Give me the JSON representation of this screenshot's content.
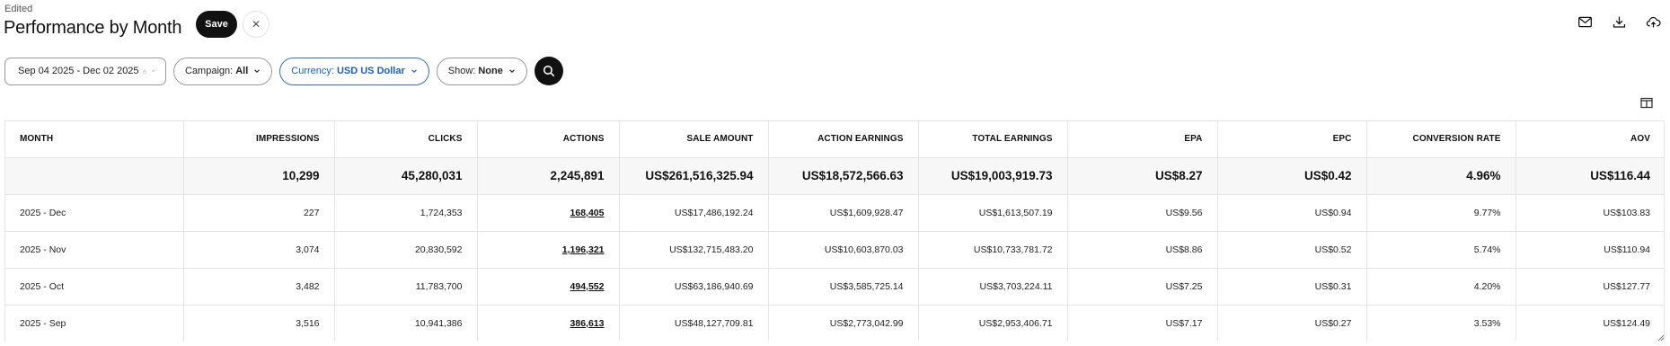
{
  "header": {
    "status": "Edited",
    "title": "Performance by Month",
    "save_label": "Save",
    "close_glyph": "✕"
  },
  "top_icons": [
    "mail-icon",
    "download-icon",
    "cloud-upload-icon"
  ],
  "filters": {
    "date_range": "Sep 04 2025 - Dec 02 2025",
    "campaign_label": "Campaign:",
    "campaign_value": "All",
    "currency_label": "Currency:",
    "currency_value": "USD US Dollar",
    "show_label": "Show:",
    "show_value": "None"
  },
  "colors": {
    "accent": "#1a5fc7",
    "dark": "#111111"
  },
  "table": {
    "columns": [
      "Month",
      "Impressions",
      "Clicks",
      "Actions",
      "Sale Amount",
      "Action Earnings",
      "Total Earnings",
      "EPA",
      "EPC",
      "Conversion Rate",
      "AOV"
    ],
    "totals": [
      "",
      "10,299",
      "45,280,031",
      "2,245,891",
      "US$261,516,325.94",
      "US$18,572,566.63",
      "US$19,003,919.73",
      "US$8.27",
      "US$0.42",
      "4.96%",
      "US$116.44"
    ],
    "rows": [
      [
        "2025 - Dec",
        "227",
        "1,724,353",
        "168,405",
        "US$17,486,192.24",
        "US$1,609,928.47",
        "US$1,613,507.19",
        "US$9.56",
        "US$0.94",
        "9.77%",
        "US$103.83"
      ],
      [
        "2025 - Nov",
        "3,074",
        "20,830,592",
        "1,196,321",
        "US$132,715,483.20",
        "US$10,603,870.03",
        "US$10,733,781.72",
        "US$8.86",
        "US$0.52",
        "5.74%",
        "US$110.94"
      ],
      [
        "2025 - Oct",
        "3,482",
        "11,783,700",
        "494,552",
        "US$63,186,940.69",
        "US$3,585,725.14",
        "US$3,703,224.11",
        "US$7.25",
        "US$0.31",
        "4.20%",
        "US$127.77"
      ],
      [
        "2025 - Sep",
        "3,516",
        "10,941,386",
        "386,613",
        "US$48,127,709.81",
        "US$2,773,042.99",
        "US$2,953,406.71",
        "US$7.17",
        "US$0.27",
        "3.53%",
        "US$124.49"
      ]
    ]
  }
}
